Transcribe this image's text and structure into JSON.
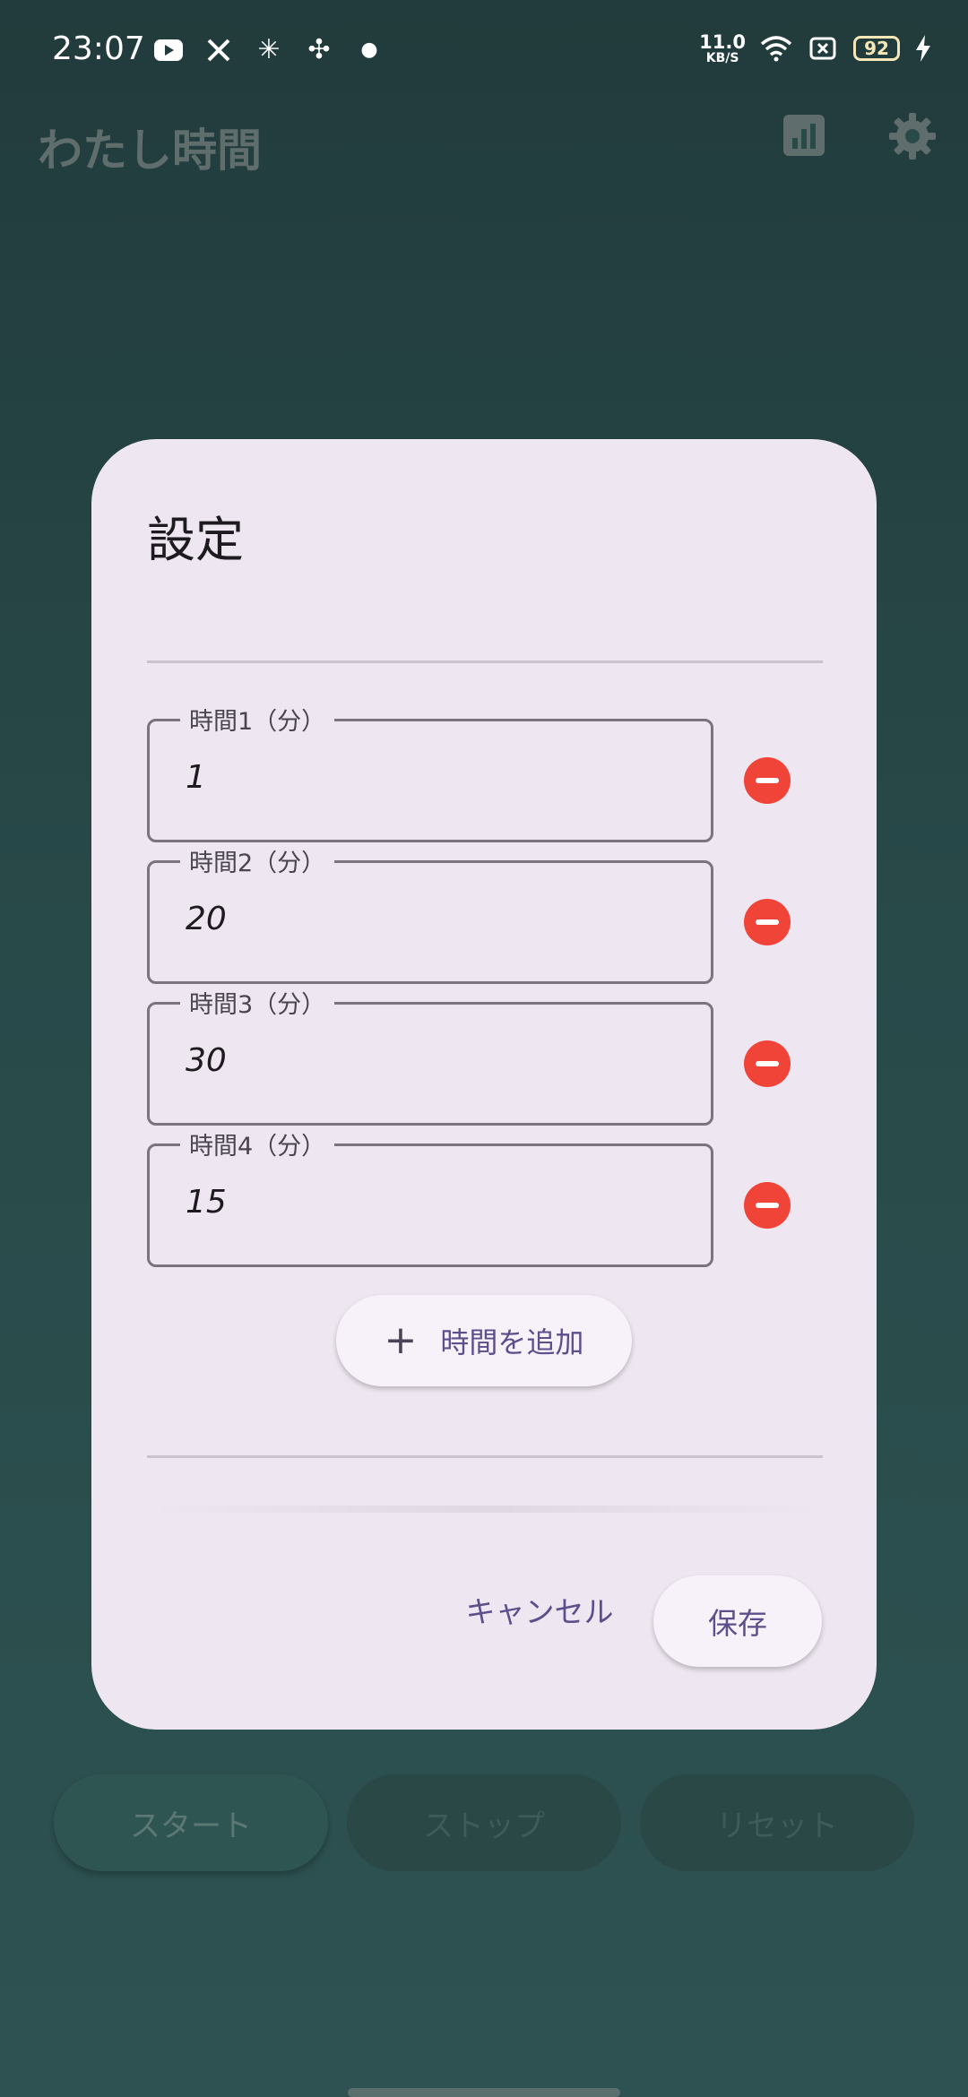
{
  "status_bar": {
    "time": "23:07",
    "icons": [
      "youtube-icon",
      "x-icon",
      "sparkle-icon",
      "pinwheel-icon",
      "dot-icon"
    ],
    "net_speed_value": "11.0",
    "net_speed_unit": "KB/S",
    "battery": "92"
  },
  "app_bar": {
    "title": "わたし時間"
  },
  "dialog": {
    "title": "設定",
    "fields": [
      {
        "label": "時間1（分）",
        "value": "1"
      },
      {
        "label": "時間2（分）",
        "value": "20"
      },
      {
        "label": "時間3（分）",
        "value": "30"
      },
      {
        "label": "時間4（分）",
        "value": "15"
      }
    ],
    "add_button_label": "時間を追加",
    "cancel_label": "キャンセル",
    "save_label": "保存"
  },
  "bottom_buttons": {
    "start": "スタート",
    "stop": "ストップ",
    "reset": "リセット"
  },
  "colors": {
    "background": "#284a49",
    "dialog_bg": "#eee6f0",
    "accent": "#5b4f8c",
    "remove": "#f04438"
  }
}
